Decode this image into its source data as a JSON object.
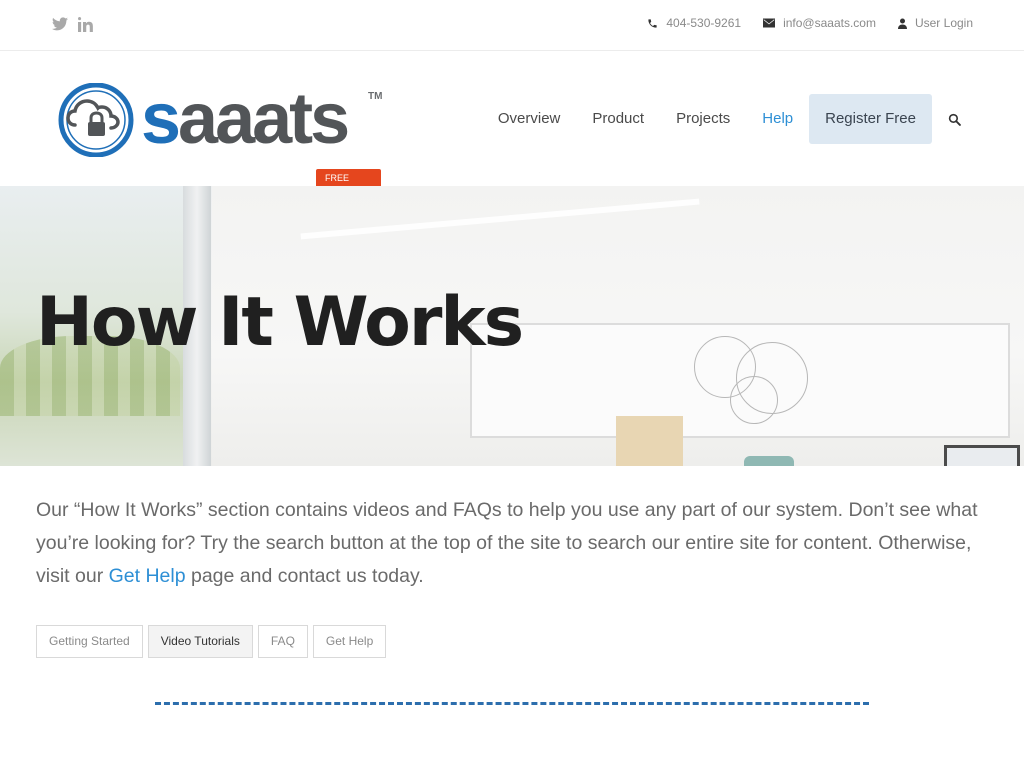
{
  "topbar": {
    "social": [
      {
        "name": "twitter-icon"
      },
      {
        "name": "linkedin-icon"
      }
    ],
    "phone": "404-530-9261",
    "email": "info@saaats.com",
    "login": "User Login"
  },
  "brand": {
    "logo_first": "s",
    "logo_rest": "aaats",
    "trademark": "TM",
    "badge": "FREE BETA",
    "colors": {
      "blue": "#1f6fb8",
      "gray": "#525558",
      "badge": "#e5461e"
    }
  },
  "nav": {
    "items": [
      {
        "label": "Overview"
      },
      {
        "label": "Product"
      },
      {
        "label": "Projects"
      },
      {
        "label": "Help"
      }
    ],
    "register": "Register Free",
    "active": "Help",
    "active_color": "#2d8fd5"
  },
  "hero": {
    "title": "How It Works"
  },
  "intro": {
    "text_before": "Our “How It Works” section contains videos and FAQs to help you use any part of our system. Don’t see what you’re looking for? Try the search button at the top of the site to search our entire site for content. Otherwise, visit our ",
    "link": "Get Help",
    "text_after": " page and contact us today."
  },
  "tabs": [
    {
      "label": "Getting Started",
      "selected": false
    },
    {
      "label": "Video Tutorials",
      "selected": true
    },
    {
      "label": "FAQ",
      "selected": false
    },
    {
      "label": "Get Help",
      "selected": false
    }
  ],
  "section": {
    "divider_color": "#2c6ead"
  }
}
